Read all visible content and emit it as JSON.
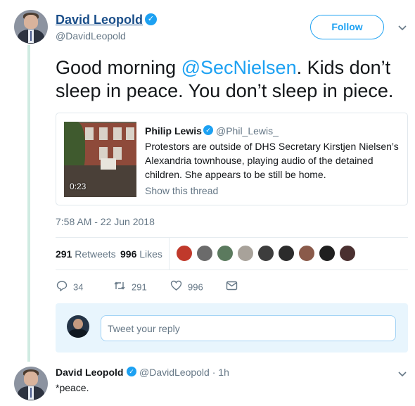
{
  "tweet": {
    "author_name": "David Leopold",
    "author_handle": "@DavidLeopold",
    "follow_label": "Follow",
    "text_before": "Good morning ",
    "mention": "@SecNielsen",
    "text_after": ". Kids don’t sleep in peace. You don’t sleep in piece.",
    "timestamp": "7:58 AM - 22 Jun 2018",
    "retweets_count": "291",
    "retweets_label": "Retweets",
    "likes_count": "996",
    "likes_label": "Likes",
    "actions": {
      "reply_count": "34",
      "retweet_count": "291",
      "like_count": "996"
    },
    "reply_placeholder": "Tweet your reply"
  },
  "quote": {
    "author_name": "Philip Lewis",
    "author_handle": "@Phil_Lewis_",
    "text": "Protestors are outside of DHS Secretary Kirstjen Nielsen’s Alexandria townhouse, playing audio of the detained children. She appears to be still be home.",
    "video_duration": "0:23",
    "show_thread_label": "Show this thread"
  },
  "reply": {
    "author_name": "David Leopold",
    "author_handle": "@DavidLeopold",
    "time": "· 1h",
    "text": "*peace."
  },
  "likers": [
    {
      "color": "#c0392b"
    },
    {
      "color": "#6b6b6b"
    },
    {
      "color": "#5b7a5e"
    },
    {
      "color": "#a8a29a"
    },
    {
      "color": "#3d3d3d"
    },
    {
      "color": "#2b2b2b"
    },
    {
      "color": "#8a5a4a"
    },
    {
      "color": "#1f1f1f"
    },
    {
      "color": "#4a3030"
    }
  ],
  "icons": {
    "verified": "verified-badge-icon",
    "chevron": "chevron-down-icon",
    "reply": "reply-icon",
    "retweet": "retweet-icon",
    "like": "heart-icon",
    "dm": "envelope-icon"
  },
  "colors": {
    "accent": "#1da1f2",
    "muted": "#657786"
  }
}
